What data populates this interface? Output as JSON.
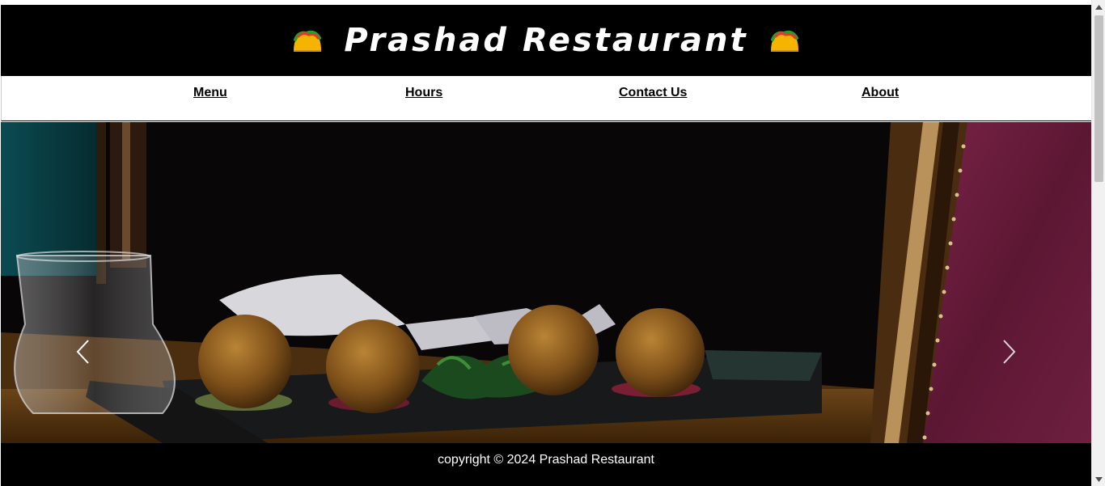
{
  "header": {
    "title": "Prashad Restaurant",
    "left_icon": "taco-icon",
    "right_icon": "taco-icon"
  },
  "nav": {
    "items": [
      {
        "label": "Menu"
      },
      {
        "label": "Hours"
      },
      {
        "label": "Contact Us"
      },
      {
        "label": "About"
      }
    ]
  },
  "carousel": {
    "prev_icon": "chevron-left-icon",
    "next_icon": "chevron-right-icon"
  },
  "footer": {
    "copyright": "copyright © 2024 Prashad Restaurant"
  },
  "scrollbar": {
    "up_icon": "scroll-up-arrow-icon",
    "down_icon": "scroll-down-arrow-icon"
  },
  "colors": {
    "header_bg": "#000000",
    "nav_bg": "#ffffff",
    "footer_bg": "#000000",
    "text_light": "#ffffff",
    "text_dark": "#000000"
  }
}
